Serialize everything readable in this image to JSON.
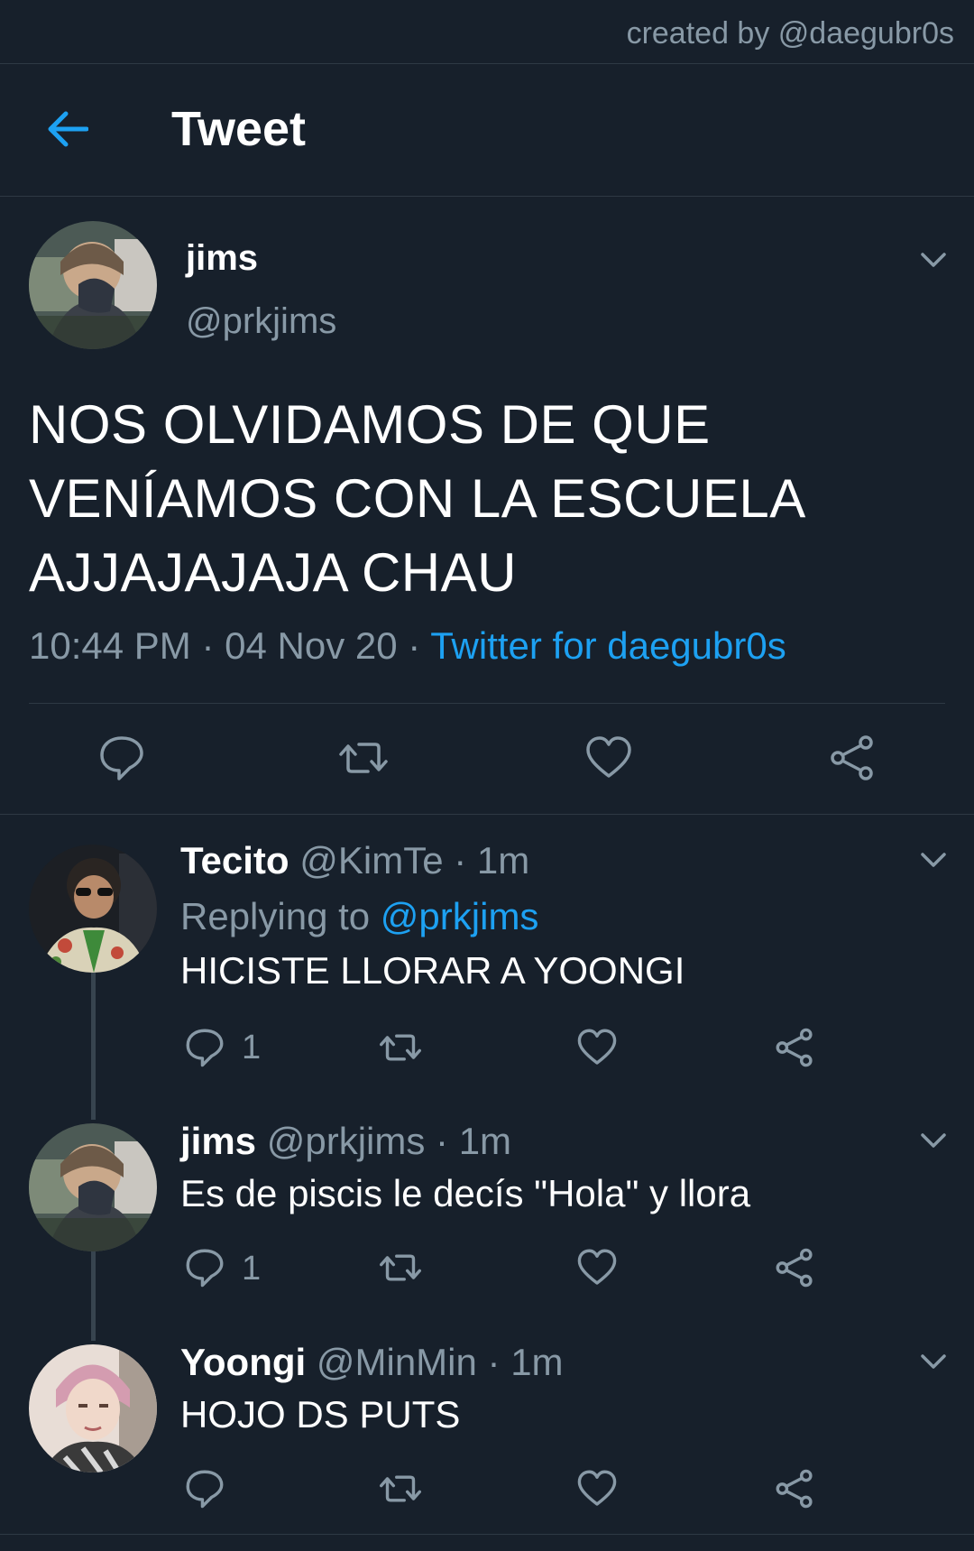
{
  "watermark": "created by @daegubr0s",
  "header": {
    "title": "Tweet",
    "back_icon": "arrow-left-icon"
  },
  "colors": {
    "background": "#17202b",
    "accent": "#1da1f2",
    "muted": "#8899a6",
    "divider": "#2e3944"
  },
  "main_tweet": {
    "name": "jims",
    "handle": "@prkjims",
    "text_lines": [
      "NOS OLVIDAMOS DE QUE",
      "VENÍAMOS CON LA ESCUELA",
      "AJJAJAJAJA CHAU"
    ],
    "time": "10:44 PM",
    "date": "04 Nov 20",
    "source": "Twitter for daegubr0s",
    "actions": [
      "reply-icon",
      "retweet-icon",
      "like-icon",
      "share-icon"
    ]
  },
  "replies": [
    {
      "name": "Tecito",
      "handle": "@KimTe",
      "age": "1m",
      "replying_label": "Replying to",
      "replying_to": "@prkjims",
      "text": "HICISTE LLORAR A YOONGI",
      "reply_count": "1"
    },
    {
      "name": "jims",
      "handle": "@prkjims",
      "age": "1m",
      "text": "Es de piscis le decís \"Hola\" y llora",
      "reply_count": "1"
    },
    {
      "name": "Yoongi",
      "handle": "@MinMin",
      "age": "1m",
      "text": "HOJO DS PUTS",
      "reply_count": ""
    }
  ],
  "separator": "·"
}
